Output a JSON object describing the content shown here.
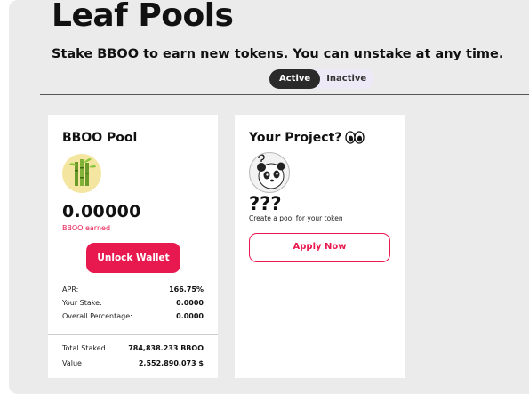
{
  "header": {
    "title": "Leaf Pools",
    "subtitle": "Stake BBOO to earn new tokens. You can unstake at any time."
  },
  "filter": {
    "active_label": "Active",
    "inactive_label": "Inactive",
    "selected": "Active"
  },
  "pool_card": {
    "title": "BBOO Pool",
    "logo_icon": "bamboo-icon",
    "earned_value": "0.00000",
    "earned_label": "BBOO earned",
    "unlock_label": "Unlock Wallet",
    "stats": [
      {
        "label": "APR:",
        "value": "166.75%"
      },
      {
        "label": "Your Stake:",
        "value": "0.0000"
      },
      {
        "label": "Overall Percentage:",
        "value": "0.0000"
      }
    ],
    "totals": [
      {
        "label": "Total Staked",
        "value": "784,838.233 BBOO"
      },
      {
        "label": "Value",
        "value": "2,552,890.073 $"
      }
    ]
  },
  "project_card": {
    "title": "Your Project?",
    "title_icon": "eyes-icon",
    "logo_icon": "panda-icon",
    "heading": "???",
    "description": "Create a pool for your token",
    "apply_label": "Apply Now"
  },
  "colors": {
    "accent": "#e8194f",
    "background": "#ebebeb",
    "card": "#ffffff",
    "toggle_active": "#2a2a2a"
  }
}
